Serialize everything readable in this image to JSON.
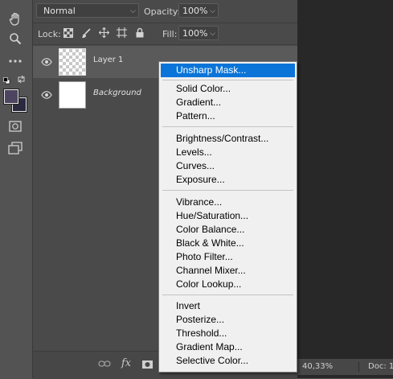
{
  "toolbar": {
    "tools": [
      "hand-icon",
      "zoom-icon",
      "more-tools-icon",
      "quick-mask-icon",
      "screen-mode-icon"
    ],
    "foreground_color": "#4d4560",
    "background_color": "#2b2940"
  },
  "layers_panel": {
    "blend_mode": "Normal",
    "opacity_label": "Opacity:",
    "opacity_value": "100%",
    "lock_label": "Lock:",
    "fill_label": "Fill:",
    "fill_value": "100%",
    "layers": [
      {
        "name": "Layer 1",
        "thumbnail": "transparent",
        "visible": true,
        "selected": true
      },
      {
        "name": "Background",
        "thumbnail": "white",
        "visible": true,
        "selected": false
      }
    ]
  },
  "status": {
    "zoom": "40,33%",
    "doc": "Doc: 1"
  },
  "context_menu": {
    "groups": [
      [
        "Unsharp Mask..."
      ],
      [
        "Solid Color...",
        "Gradient...",
        "Pattern..."
      ],
      [
        "Brightness/Contrast...",
        "Levels...",
        "Curves...",
        "Exposure..."
      ],
      [
        "Vibrance...",
        "Hue/Saturation...",
        "Color Balance...",
        "Black & White...",
        "Photo Filter...",
        "Channel Mixer...",
        "Color Lookup..."
      ],
      [
        "Invert",
        "Posterize...",
        "Threshold...",
        "Gradient Map...",
        "Selective Color..."
      ]
    ],
    "highlighted": "Unsharp Mask...",
    "highlight_color": "#0a74d8"
  }
}
